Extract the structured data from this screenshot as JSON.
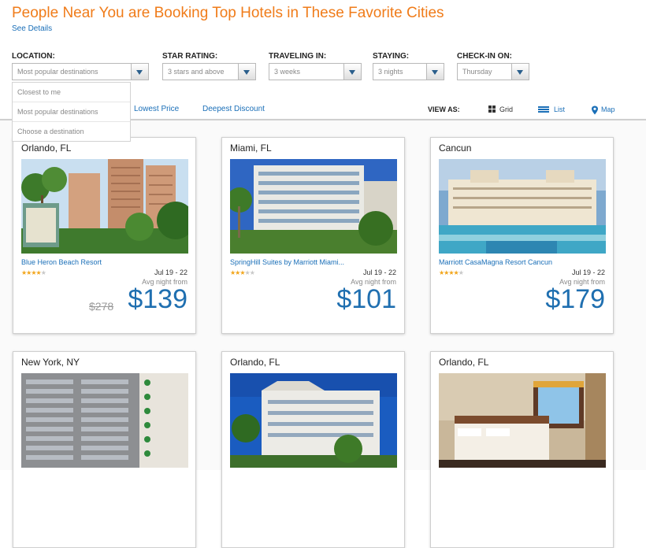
{
  "header": {
    "title": "People Near You are Booking Top Hotels in These Favorite Cities",
    "see_details": "See Details"
  },
  "filters": {
    "location": {
      "label": "LOCATION:",
      "value": "Most popular destinations",
      "options": [
        "Closest to me",
        "Most popular destinations",
        "Choose a destination"
      ]
    },
    "star_rating": {
      "label": "STAR RATING:",
      "value": "3 stars and above"
    },
    "traveling_in": {
      "label": "TRAVELING IN:",
      "value": "3 weeks"
    },
    "staying": {
      "label": "STAYING:",
      "value": "3 nights"
    },
    "check_in_on": {
      "label": "CHECK-IN ON:",
      "value": "Thursday"
    }
  },
  "sort": {
    "lowest_price": "Lowest Price",
    "deepest_discount": "Deepest Discount"
  },
  "view_as": {
    "label": "VIEW AS:",
    "grid": "Grid",
    "list": "List",
    "map": "Map",
    "active": "List"
  },
  "colors": {
    "title": "#f07c1a",
    "link": "#1a6fb8",
    "price": "#1f6fb0",
    "star": "#f2a51a"
  },
  "cards": [
    {
      "city": "Orlando, FL",
      "hotel": "Blue Heron Beach Resort",
      "stars": 3.5,
      "dates": "Jul 19 - 22",
      "avg_label": "Avg night from",
      "old_price": "$278",
      "price": "$139"
    },
    {
      "city": "Miami, FL",
      "hotel": "SpringHill Suites by Marriott Miami...",
      "stars": 3,
      "dates": "Jul 19 - 22",
      "avg_label": "Avg night from",
      "old_price": "",
      "price": "$101"
    },
    {
      "city": "Cancun",
      "hotel": "Marriott CasaMagna Resort Cancun",
      "stars": 4,
      "dates": "Jul 19 - 22",
      "avg_label": "Avg night from",
      "old_price": "",
      "price": "$179"
    },
    {
      "city": "New York, NY"
    },
    {
      "city": "Orlando, FL"
    },
    {
      "city": "Orlando, FL"
    }
  ]
}
